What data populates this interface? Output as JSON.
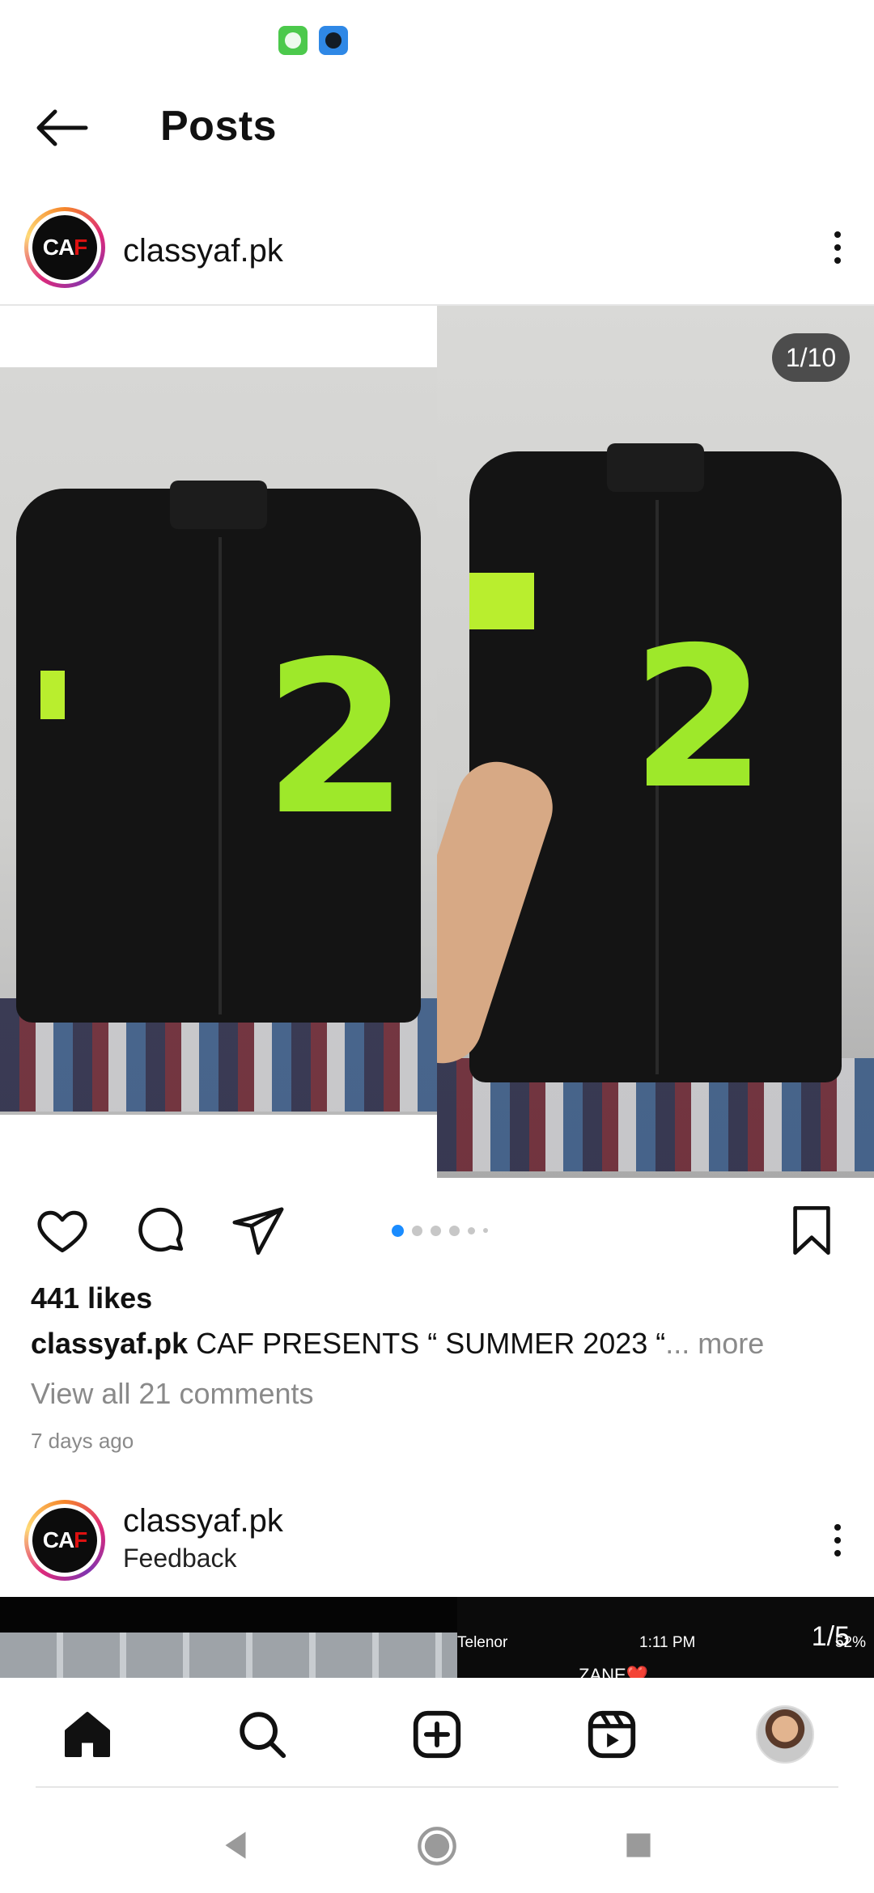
{
  "status_bar": {
    "icons": [
      "app-green-icon",
      "pool-game-icon"
    ]
  },
  "header": {
    "title": "Posts",
    "back_icon": "arrow-left-icon"
  },
  "post1": {
    "username": "classyaf.pk",
    "avatar_logo": "CAF",
    "media_counter": "1/10",
    "shirt_number": "2",
    "carousel_total": 6,
    "carousel_active": 1,
    "likes": "441 likes",
    "caption_user": "classyaf.pk",
    "caption_text": "CAF PRESENTS “ SUMMER 2023 “",
    "caption_more": "... more",
    "comments": "View all 21 comments",
    "time_ago": "7 days ago"
  },
  "post2": {
    "username": "classyaf.pk",
    "subtitle": "Feedback",
    "avatar_logo": "CAF",
    "media_counter": "1/5",
    "phone_carrier": "Telenor",
    "phone_time": "1:11 PM",
    "phone_battery": "52%",
    "phone_name": "ZANE❤️"
  },
  "bottom_nav": {
    "items": [
      "home-icon",
      "search-icon",
      "create-icon",
      "reels-icon",
      "profile-avatar"
    ]
  },
  "system_nav": {
    "items": [
      "back-triangle-icon",
      "home-circle-icon",
      "recents-square-icon"
    ]
  },
  "colors": {
    "accent_blue": "#1a8cff",
    "muted_text": "#8a8a8a",
    "neon_green": "#9ee82a"
  }
}
